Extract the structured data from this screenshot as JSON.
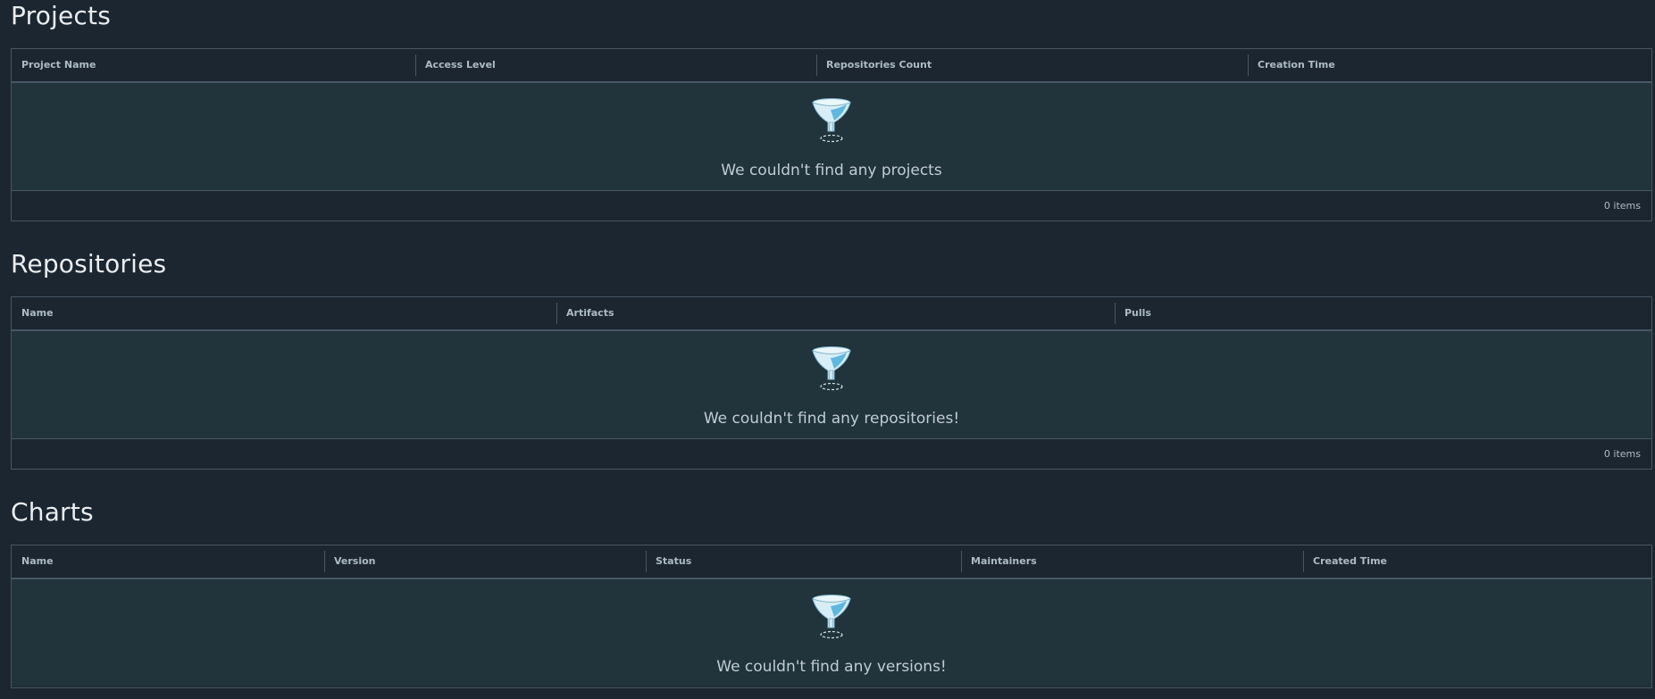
{
  "projects": {
    "title": "Projects",
    "columns": [
      "Project Name",
      "Access Level",
      "Repositories Count",
      "Creation Time"
    ],
    "empty_message": "We couldn't find any projects",
    "footer_count": "0 items"
  },
  "repositories": {
    "title": "Repositories",
    "columns": [
      "Name",
      "Artifacts",
      "Pulls"
    ],
    "empty_message": "We couldn't find any repositories!",
    "footer_count": "0 items"
  },
  "charts": {
    "title": "Charts",
    "columns": [
      "Name",
      "Version",
      "Status",
      "Maintainers",
      "Created Time"
    ],
    "empty_message": "We couldn't find any versions!"
  },
  "icons": {
    "empty_placeholder": "filter-funnel-icon"
  },
  "colors": {
    "background": "#1b2631",
    "empty_row_background": "#21333b",
    "border": "#485764",
    "title_text": "#eaedf0",
    "header_text": "#adbbc4"
  }
}
